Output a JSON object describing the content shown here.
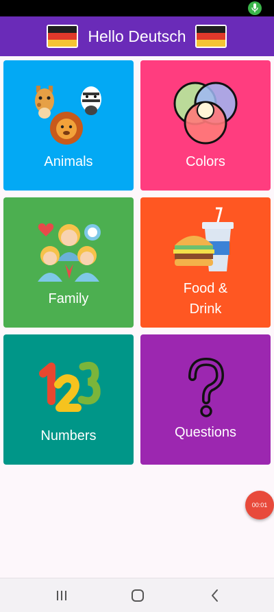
{
  "app_bar": {
    "title": "Hello Deutsch",
    "left_icon": "german-flag-icon",
    "right_icon": "german-flag-icon"
  },
  "status_bar": {
    "icon": "mic-icon"
  },
  "categories": [
    {
      "label": "Animals",
      "color": "#03a9f4",
      "icon": "animals-icon"
    },
    {
      "label": "Colors",
      "color": "#ff3d7f",
      "icon": "color-circles-icon"
    },
    {
      "label": "Family",
      "color": "#4caf50",
      "icon": "family-icon"
    },
    {
      "label": "Food &\nDrink",
      "color": "#ff5722",
      "icon": "burger-drink-icon"
    },
    {
      "label": "Numbers",
      "color": "#009688",
      "icon": "numbers-123-icon"
    },
    {
      "label": "Questions",
      "color": "#9c27b0",
      "icon": "question-mark-icon"
    }
  ],
  "timer": {
    "label": "00:01"
  },
  "nav": {
    "recent_icon": "recent-apps-icon",
    "home_icon": "home-icon",
    "back_icon": "back-icon"
  }
}
